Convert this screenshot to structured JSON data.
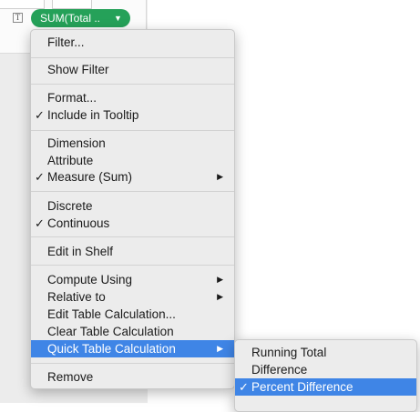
{
  "pill": {
    "label": "SUM(Total ..",
    "caret": "▼",
    "color": "#25a159"
  },
  "marks_icon": "T",
  "checkmark": "✓",
  "submenu_arrow": "▶",
  "highlight_color": "#3f85e6",
  "main_menu": {
    "items": [
      {
        "label": "Filter..."
      },
      {
        "label": "Show Filter"
      },
      {
        "label": "Format..."
      },
      {
        "label": "Include in Tooltip",
        "checked": true
      },
      {
        "label": "Dimension"
      },
      {
        "label": "Attribute"
      },
      {
        "label": "Measure (Sum)",
        "checked": true,
        "submenu": true
      },
      {
        "label": "Discrete"
      },
      {
        "label": "Continuous",
        "checked": true
      },
      {
        "label": "Edit in Shelf"
      },
      {
        "label": "Compute Using",
        "submenu": true
      },
      {
        "label": "Relative to",
        "submenu": true
      },
      {
        "label": "Edit Table Calculation..."
      },
      {
        "label": "Clear Table Calculation"
      },
      {
        "label": "Quick Table Calculation",
        "submenu": true,
        "highlighted": true
      },
      {
        "label": "Remove"
      }
    ]
  },
  "sub_menu": {
    "items": [
      {
        "label": "Running Total"
      },
      {
        "label": "Difference"
      },
      {
        "label": "Percent Difference",
        "checked": true,
        "highlighted": true
      }
    ]
  }
}
